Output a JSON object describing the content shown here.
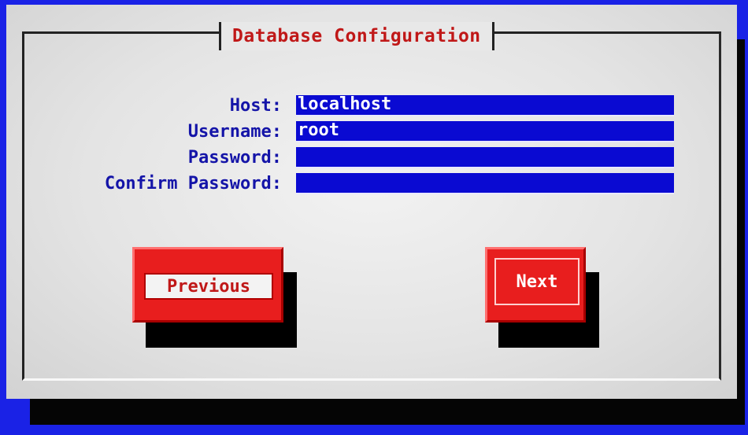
{
  "dialog": {
    "title": "Database Configuration"
  },
  "form": {
    "fields": [
      {
        "label": "Host:",
        "value": "localhost"
      },
      {
        "label": "Username:",
        "value": "root"
      },
      {
        "label": "Password:",
        "value": ""
      },
      {
        "label": "Confirm Password:",
        "value": ""
      }
    ]
  },
  "buttons": {
    "previous_label": "Previous",
    "next_label": "Next"
  },
  "colors": {
    "background": "#1a22e6",
    "title_text": "#c01818",
    "label_text": "#1414a8",
    "field_background": "#0a0ad2",
    "button": "#e81e1e"
  }
}
